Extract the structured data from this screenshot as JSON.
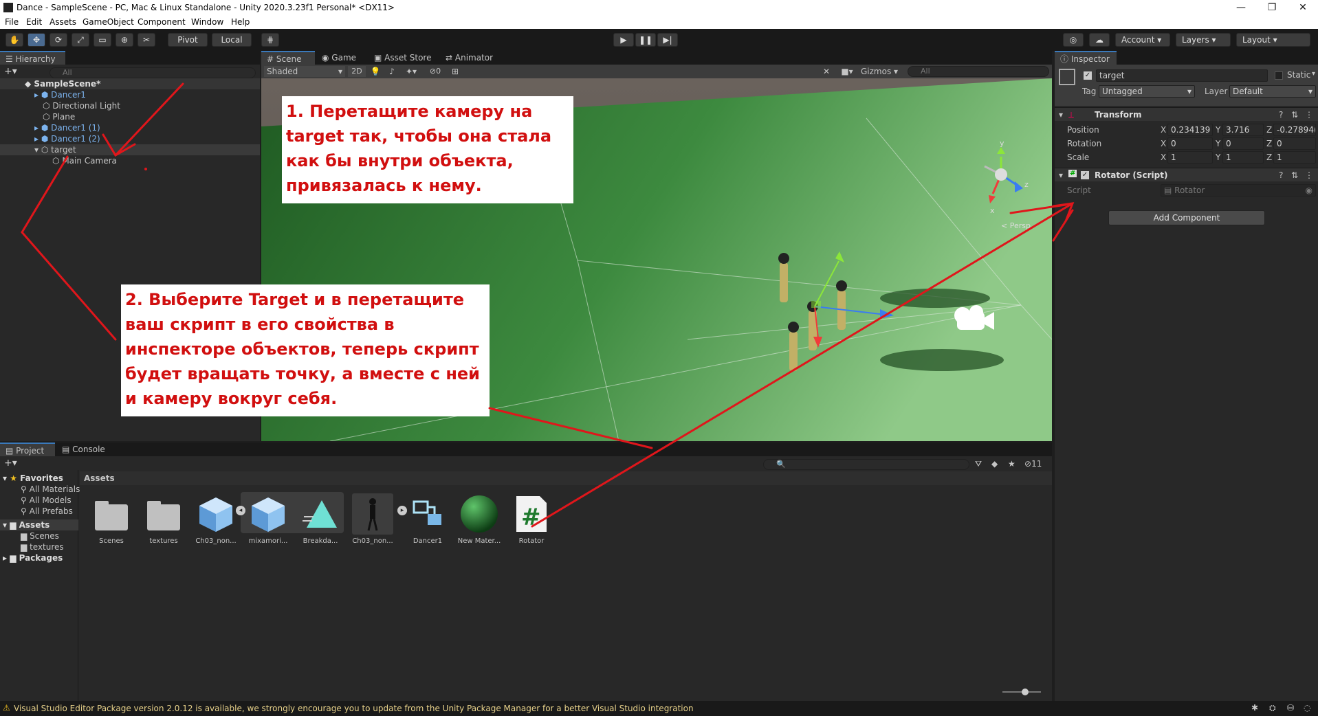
{
  "window": {
    "title": "Dance - SampleScene - PC, Mac & Linux Standalone - Unity 2020.3.23f1 Personal* <DX11>",
    "minimize": "—",
    "restore": "❐",
    "close": "✕"
  },
  "menu": [
    "File",
    "Edit",
    "Assets",
    "GameObject",
    "Component",
    "Window",
    "Help"
  ],
  "toolbar": {
    "pivot": "Pivot",
    "local": "Local",
    "account": "Account",
    "layers": "Layers",
    "layout": "Layout"
  },
  "hierarchy": {
    "tab": "Hierarchy",
    "search_placeholder": "All",
    "items": [
      {
        "label": "SampleScene*",
        "kind": "scene"
      },
      {
        "label": "Dancer1",
        "kind": "prefab"
      },
      {
        "label": "Directional Light",
        "kind": "object"
      },
      {
        "label": "Plane",
        "kind": "object"
      },
      {
        "label": "Dancer1 (1)",
        "kind": "prefab"
      },
      {
        "label": "Dancer1 (2)",
        "kind": "prefab"
      },
      {
        "label": "target",
        "kind": "object"
      },
      {
        "label": "Main Camera",
        "kind": "object"
      }
    ]
  },
  "scene": {
    "tabs": [
      "Scene",
      "Game",
      "Asset Store",
      "Animator"
    ],
    "shading": "Shaded",
    "mode2d": "2D",
    "gizmos": "Gizmos",
    "search_placeholder": "All",
    "persp": "< Persp",
    "fx_count": "0",
    "axes": {
      "x": "x",
      "y": "y",
      "z": "z"
    }
  },
  "inspector": {
    "tab": "Inspector",
    "object_name": "target",
    "static_label": "Static",
    "tag_label": "Tag",
    "tag_value": "Untagged",
    "layer_label": "Layer",
    "layer_value": "Default",
    "transform": {
      "title": "Transform",
      "rows": [
        {
          "label": "Position",
          "x": "0.234139",
          "y": "3.716",
          "z": "-0.27894("
        },
        {
          "label": "Rotation",
          "x": "0",
          "y": "0",
          "z": "0"
        },
        {
          "label": "Scale",
          "x": "1",
          "y": "1",
          "z": "1"
        }
      ]
    },
    "rotator": {
      "title": "Rotator (Script)",
      "script_label": "Script",
      "script_value": "Rotator"
    },
    "add_component": "Add Component"
  },
  "project": {
    "tabs": [
      "Project",
      "Console"
    ],
    "favorites_label": "Favorites",
    "favorites": [
      "All Materials",
      "All Models",
      "All Prefabs"
    ],
    "assets_label": "Assets",
    "assets_folders": [
      "Scenes",
      "textures"
    ],
    "packages_label": "Packages",
    "breadcrumb": "Assets",
    "hidden_count": "11",
    "assets": [
      {
        "name": "Scenes",
        "type": "folder"
      },
      {
        "name": "textures",
        "type": "folder"
      },
      {
        "name": "Ch03_non...",
        "type": "model"
      },
      {
        "name": "mixamori...",
        "type": "model"
      },
      {
        "name": "Breakda...",
        "type": "anim"
      },
      {
        "name": "Ch03_non...",
        "type": "character"
      },
      {
        "name": "Dancer1",
        "type": "prefab"
      },
      {
        "name": "New Mater...",
        "type": "material"
      },
      {
        "name": "Rotator",
        "type": "script"
      }
    ]
  },
  "notes": {
    "note1": "1. Перетащите камеру на target так, чтобы она стала как бы внутри объекта, привязалась к нему.",
    "note2": "2. Выберите Target и в перетащите ваш скрипт в его свойства в инспекторе объектов, теперь скрипт будет вращать точку, а вместе с ней и камеру вокруг себя."
  },
  "status": {
    "message": "Visual Studio Editor Package version 2.0.12 is available, we strongly encourage you to update from the Unity Package Manager for a better Visual Studio integration"
  },
  "colors": {
    "annotation": "#e0161b",
    "accent": "#3a79bb",
    "ground": "#3e8a42"
  }
}
